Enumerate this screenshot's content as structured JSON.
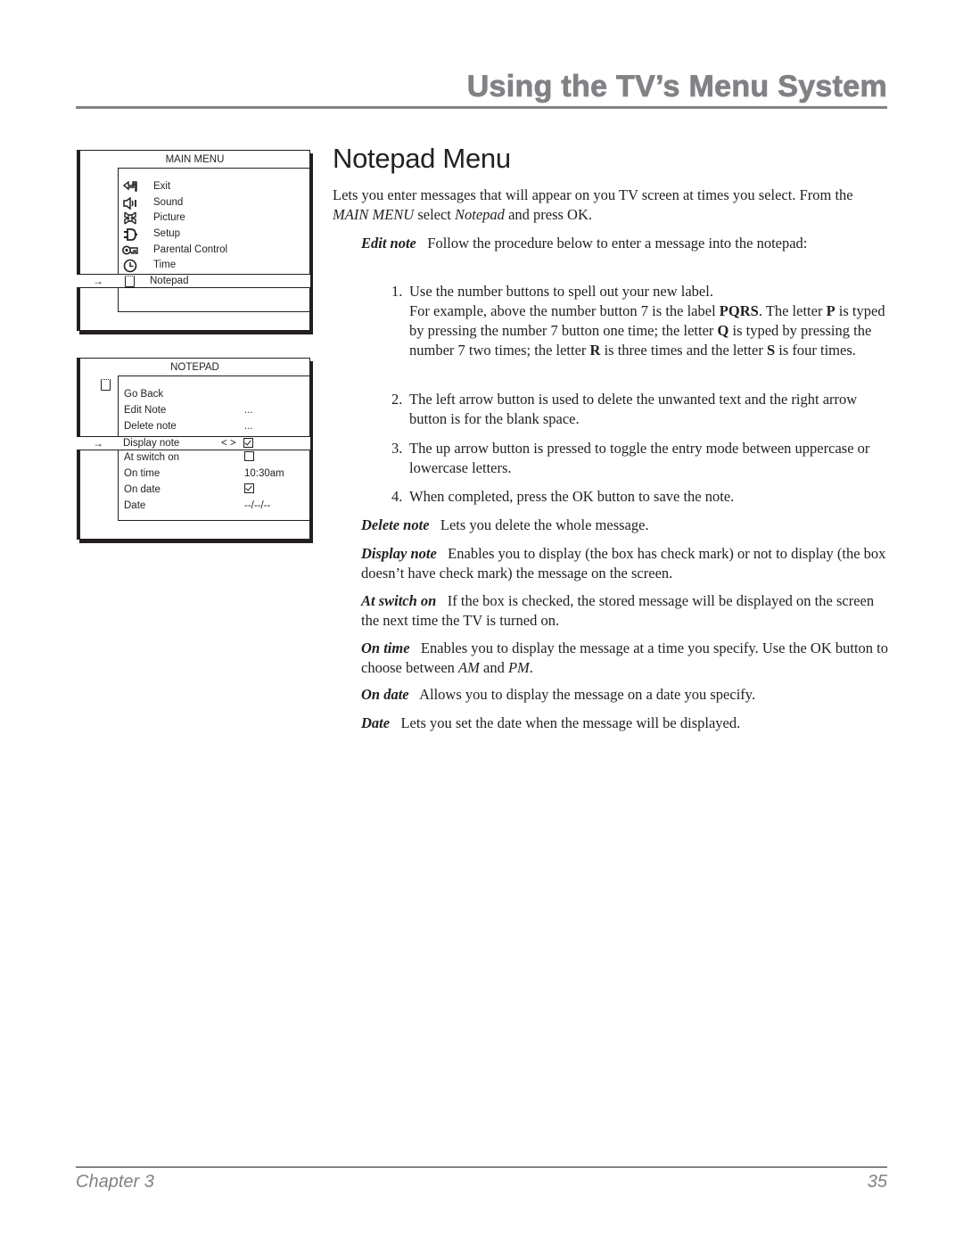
{
  "header": {
    "title": "Using the TV’s Menu System"
  },
  "main_menu": {
    "title": "MAIN MENU",
    "items": [
      {
        "label": "Exit",
        "icon": "exit-icon",
        "glyph": "⮌"
      },
      {
        "label": "Sound",
        "icon": "sound-icon",
        "glyph": "🕩"
      },
      {
        "label": "Picture",
        "icon": "picture-icon",
        "glyph": "✿"
      },
      {
        "label": "Setup",
        "icon": "setup-icon",
        "glyph": "⏻"
      },
      {
        "label": "Parental Control",
        "icon": "parental-control-key-icon",
        "glyph": "⚿"
      },
      {
        "label": "Time",
        "icon": "clock-icon",
        "glyph": "◷"
      },
      {
        "label": "Notepad",
        "icon": "notepad-icon",
        "glyph": ""
      }
    ],
    "selected_index": 6,
    "arrow": "→"
  },
  "notepad_menu": {
    "title": "NOTEPAD",
    "items": [
      {
        "label": "Go Back",
        "value": ""
      },
      {
        "label": "Edit Note",
        "value": "..."
      },
      {
        "label": "Delete note",
        "value": "..."
      },
      {
        "label": "Display note",
        "value": "checked",
        "nav": "< >"
      },
      {
        "label": "At switch on",
        "value": "unchecked"
      },
      {
        "label": "On time",
        "value": "10:30am"
      },
      {
        "label": "On date",
        "value": "checked"
      },
      {
        "label": "Date",
        "value": "--/--/--"
      }
    ],
    "selected_index": 3,
    "arrow": "→"
  },
  "content": {
    "title": "Notepad Menu",
    "intro": {
      "t1": "Lets you enter messages that will appear on you TV screen at times you select. From the ",
      "i1": "MAIN MENU",
      "t2": " select ",
      "i2": "Notepad",
      "t3": " and press OK."
    },
    "edit_note": {
      "term": "Edit note",
      "text": "Follow the procedure below to enter a message into the notepad:"
    },
    "steps": [
      {
        "num": "1.",
        "line1": "Use the number buttons to spell out your new label.",
        "a": "For example, above the number button 7 is the label ",
        "b1": "PQRS",
        "c": ". The letter ",
        "b2": "P",
        "d": " is typed by pressing the number 7 button one time; the letter ",
        "b3": "Q",
        "e": " is typed by pressing the number 7 two times; the letter ",
        "b4": "R",
        "f": " is three times and the letter ",
        "b5": "S",
        "g": " is four times."
      },
      {
        "num": "2.",
        "text": "The left arrow button is used to delete the unwanted text and the right arrow button is for the blank space."
      },
      {
        "num": "3.",
        "text": "The up arrow button is pressed to toggle the entry mode between uppercase or lowercase letters."
      },
      {
        "num": "4.",
        "text": "When completed, press the OK button to save the note."
      }
    ],
    "delete_note": {
      "term": "Delete note",
      "text": "Lets you delete the whole message."
    },
    "display_note": {
      "term": "Display note",
      "text": "Enables you to display (the box has check mark) or not to display (the box doesn’t have check mark) the message on the screen."
    },
    "at_switch_on": {
      "term": "At switch on",
      "text": "If the box is checked, the stored message will be displayed on the screen the next time the TV is turned on."
    },
    "on_time": {
      "term": "On time",
      "text1": "Enables you to display the message at a time you specify. Use the OK button to choose between ",
      "i1": "AM",
      "text2": " and ",
      "i2": "PM",
      "text3": "."
    },
    "on_date": {
      "term": "On date",
      "text": "Allows you to display the message on a date you specify."
    },
    "date": {
      "term": "Date",
      "text": "Lets you set the date when the message will be displayed."
    }
  },
  "footer": {
    "chapter": "Chapter 3",
    "page": "35"
  }
}
